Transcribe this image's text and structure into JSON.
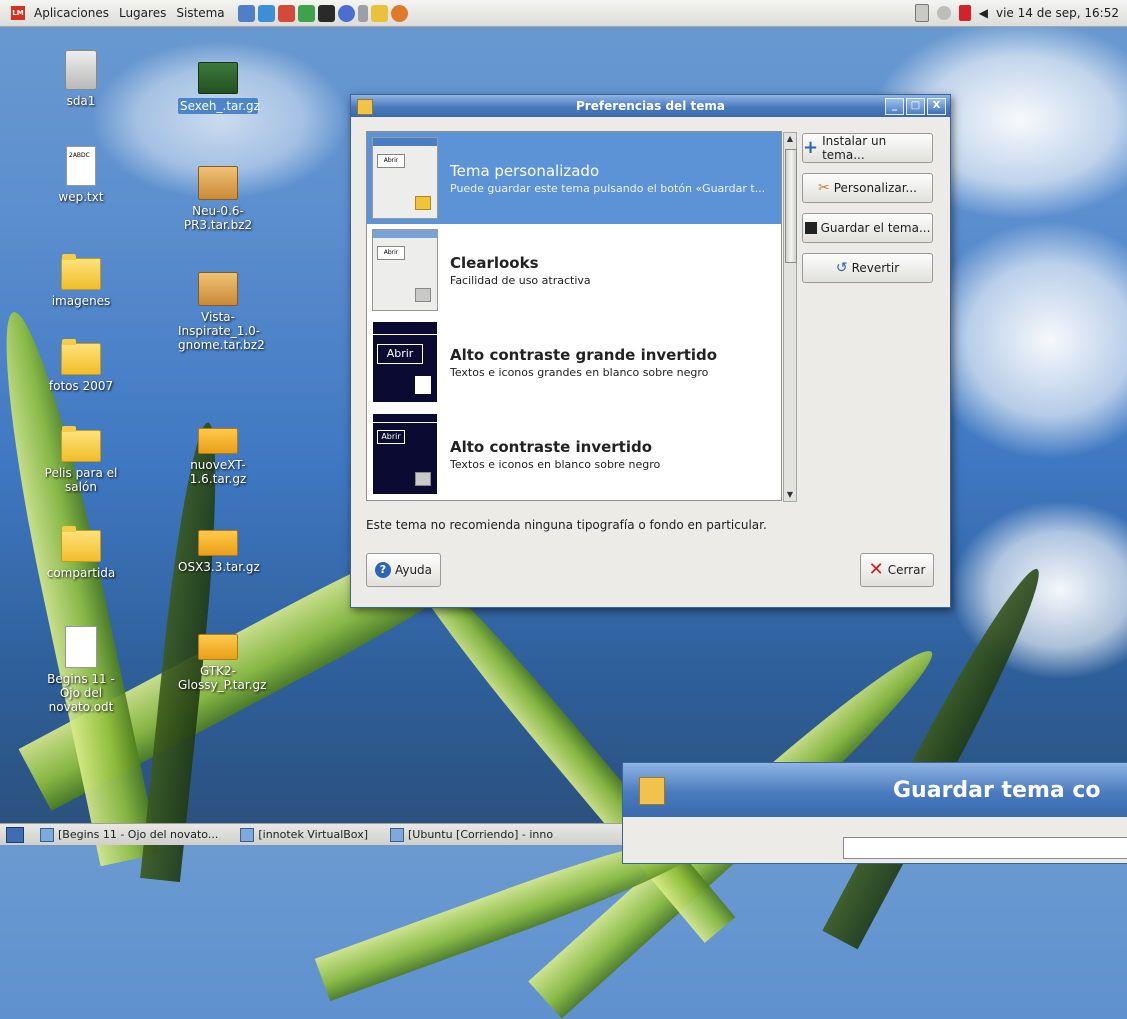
{
  "top_panel": {
    "menus": [
      "Aplicaciones",
      "Lugares",
      "Sistema"
    ],
    "logo_text": "LM",
    "launchers": [
      "files-icon",
      "monitor-icon",
      "network-icon",
      "chat-icon",
      "terminal-icon",
      "messenger-icon",
      "app-icon",
      "paint-icon",
      "firefox-icon"
    ],
    "clock": "vie 14 de sep, 16:52"
  },
  "desktop": {
    "icons": [
      {
        "label": "sda1",
        "icon": "drive-icon"
      },
      {
        "label": "wep.txt",
        "icon": "text-file-icon",
        "preview": "2ABDC"
      },
      {
        "label": "imagenes",
        "icon": "folder-icon"
      },
      {
        "label": "fotos 2007",
        "icon": "folder-icon"
      },
      {
        "label": "Pelis para el salón",
        "icon": "folder-icon"
      },
      {
        "label": "compartida",
        "icon": "folder-icon"
      },
      {
        "label": "Begins 11 - Ojo del novato.odt",
        "icon": "document-icon"
      },
      {
        "label": "Sexeh_.tar.gz",
        "icon": "archive-icon",
        "selected": true
      },
      {
        "label": "Neu-0.6-PR3.tar.bz2",
        "icon": "archive-icon"
      },
      {
        "label": "Vista-Inspirate_1.0-gnome.tar.bz2",
        "icon": "archive-icon"
      },
      {
        "label": "nuoveXT-1.6.tar.gz",
        "icon": "archive-icon"
      },
      {
        "label": "OSX3.3.tar.gz",
        "icon": "archive-icon"
      },
      {
        "label": "GTK2-Glossy_P.tar.gz",
        "icon": "archive-icon"
      }
    ]
  },
  "window": {
    "title": "Preferencias del tema",
    "buttons": {
      "minimize": "_",
      "maximize": "□",
      "close": "X"
    },
    "themes": [
      {
        "name": "Tema personalizado",
        "desc": "Puede guardar este tema pulsando el botón «Guardar t...",
        "selected": true,
        "thumb_btn": "Abrir"
      },
      {
        "name": "Clearlooks",
        "desc": "Facilidad de uso atractiva",
        "selected": false,
        "thumb_btn": "Abrir"
      },
      {
        "name": "Alto contraste grande invertido",
        "desc": "Textos e iconos grandes en blanco sobre negro",
        "selected": false,
        "thumb_btn": "Abrir"
      },
      {
        "name": "Alto contraste invertido",
        "desc": "Textos e iconos en blanco sobre negro",
        "selected": false,
        "thumb_btn": "Abrir"
      }
    ],
    "side_buttons": {
      "install": "Instalar un tema...",
      "customize": "Personalizar...",
      "save": "Guardar el tema...",
      "revert": "Revertir"
    },
    "hint": "Este tema no recomienda ninguna tipografía o fondo en particular.",
    "help": "Ayuda",
    "close": "Cerrar"
  },
  "second_window": {
    "title": "Guardar tema co"
  },
  "taskbar": {
    "tasks": [
      "[Begins 11 - Ojo del novato...",
      "[innotek VirtualBox]",
      "[Ubuntu [Corriendo] - inno"
    ]
  },
  "colors": {
    "accent": "#5b93d6",
    "titlebar": "#4a7bbf",
    "close_red": "#d31b1b"
  }
}
